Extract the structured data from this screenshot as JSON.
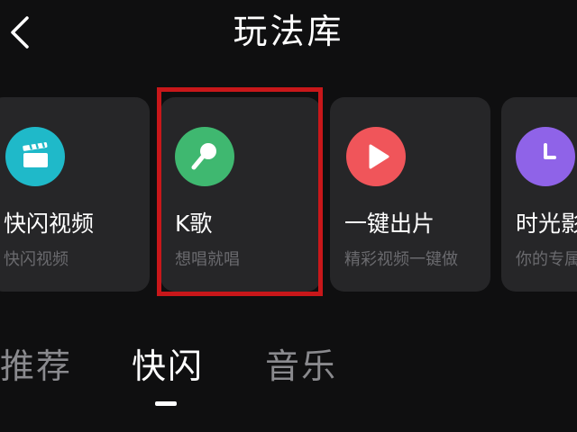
{
  "header": {
    "title": "玩法库",
    "back_icon": "chevron-left-icon"
  },
  "cards": [
    {
      "title": "快闪视频",
      "subtitle": "快闪视频",
      "icon": "clapperboard-icon",
      "icon_color": "#1fb9c9"
    },
    {
      "title": "K歌",
      "subtitle": "想唱就唱",
      "icon": "microphone-icon",
      "icon_color": "#3fb870"
    },
    {
      "title": "一键出片",
      "subtitle": "精彩视频一键做",
      "icon": "play-icon",
      "icon_color": "#f0555a"
    },
    {
      "title": "时光影",
      "subtitle": "你的专属",
      "icon": "clock-icon",
      "icon_color": "#8f63e8"
    }
  ],
  "highlight": {
    "color": "#c8171a",
    "target": "K歌"
  },
  "tabs": [
    {
      "label": "推荐",
      "active": false
    },
    {
      "label": "快闪",
      "active": true
    },
    {
      "label": "音乐",
      "active": false
    }
  ]
}
